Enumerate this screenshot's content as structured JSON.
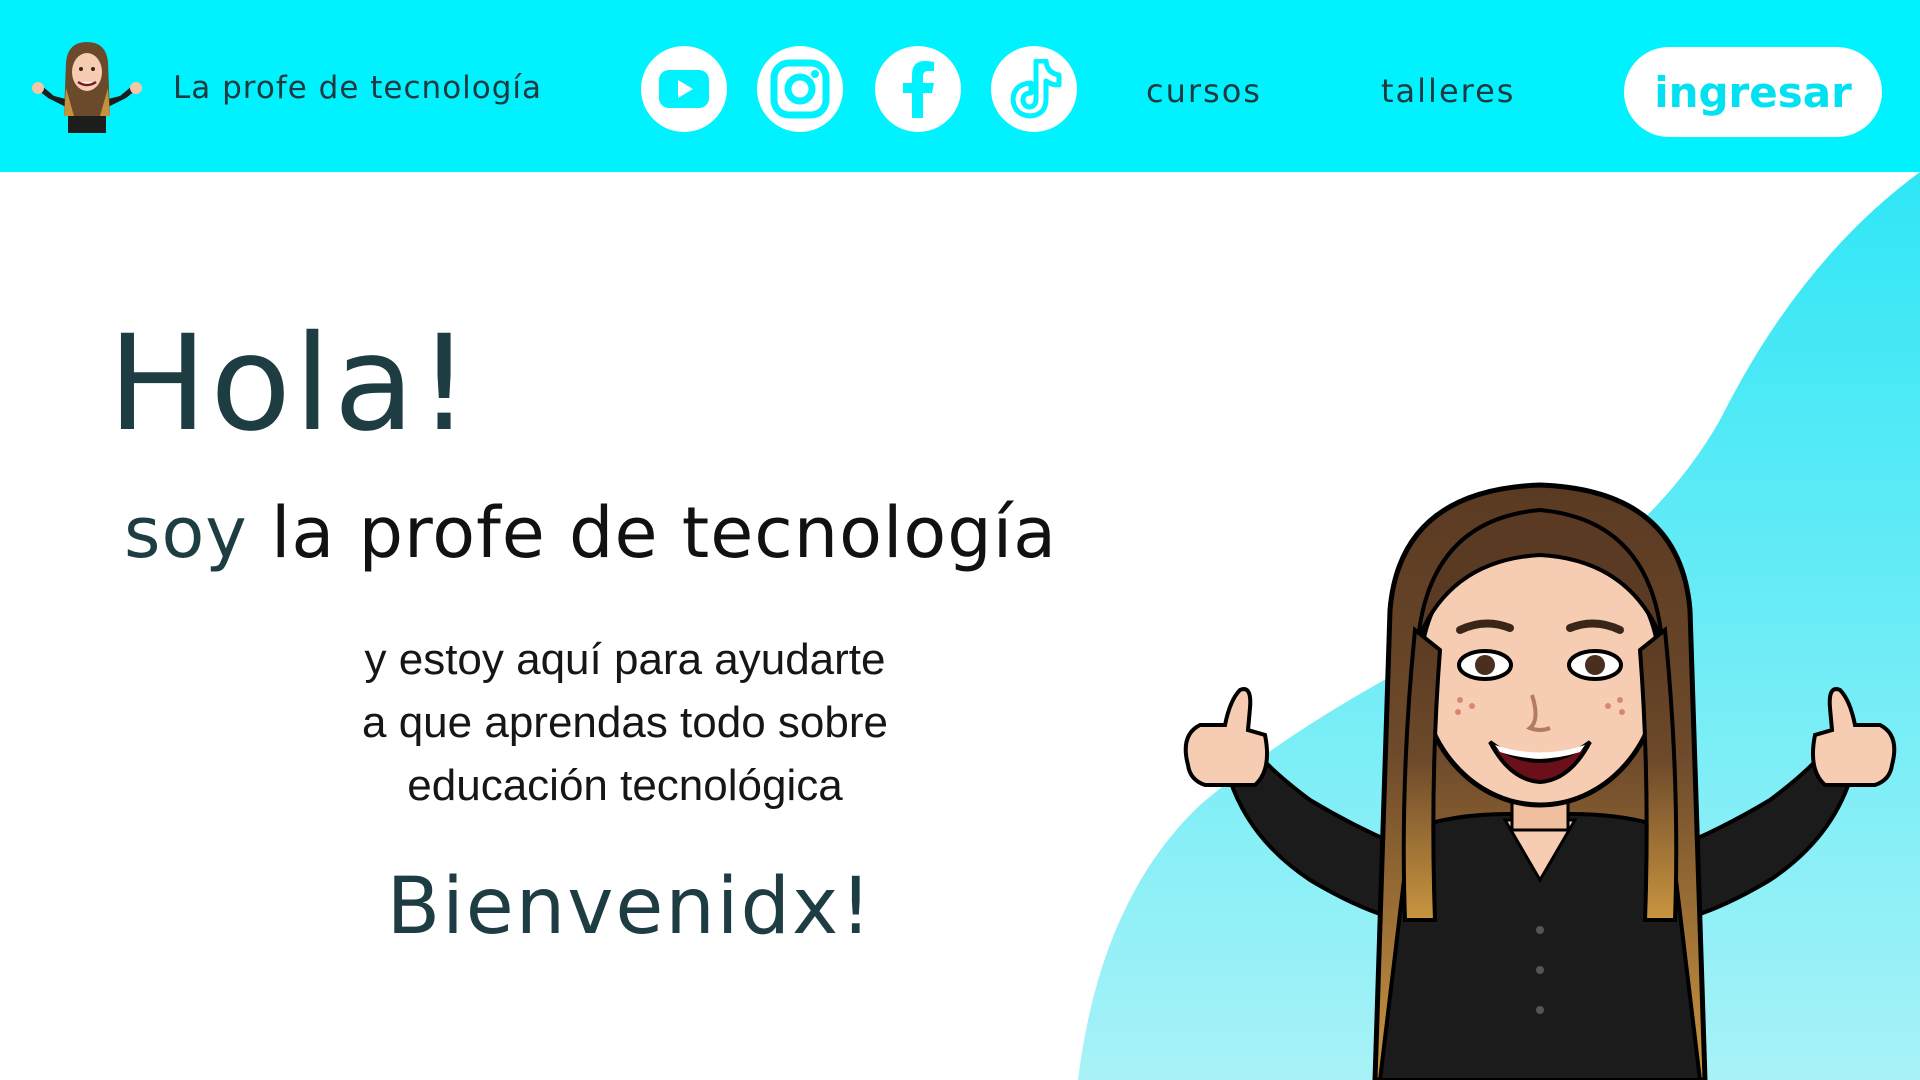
{
  "header": {
    "brand": "La profe de tecnología",
    "social": [
      {
        "name": "youtube-icon",
        "color": "#ff0000"
      },
      {
        "name": "instagram-icon",
        "color": "#00f2fe"
      },
      {
        "name": "facebook-icon",
        "color": "#00f2fe"
      },
      {
        "name": "tiktok-icon",
        "color": "#00f2fe"
      }
    ],
    "nav": [
      "cursos",
      "talleres"
    ],
    "login_label": "ingresar"
  },
  "hero": {
    "title": "Hola!",
    "subtitle_soy": "soy",
    "subtitle_rest": " la profe de tecnología",
    "description": [
      "y estoy aquí para ayudarte",
      "a que aprendas todo sobre",
      " educación tecnológica"
    ],
    "welcome": "Bienvenidx!"
  },
  "colors": {
    "header_bg": "#00f2fe",
    "accent": "#00e1f2",
    "text_dark": "#1e3d42"
  }
}
